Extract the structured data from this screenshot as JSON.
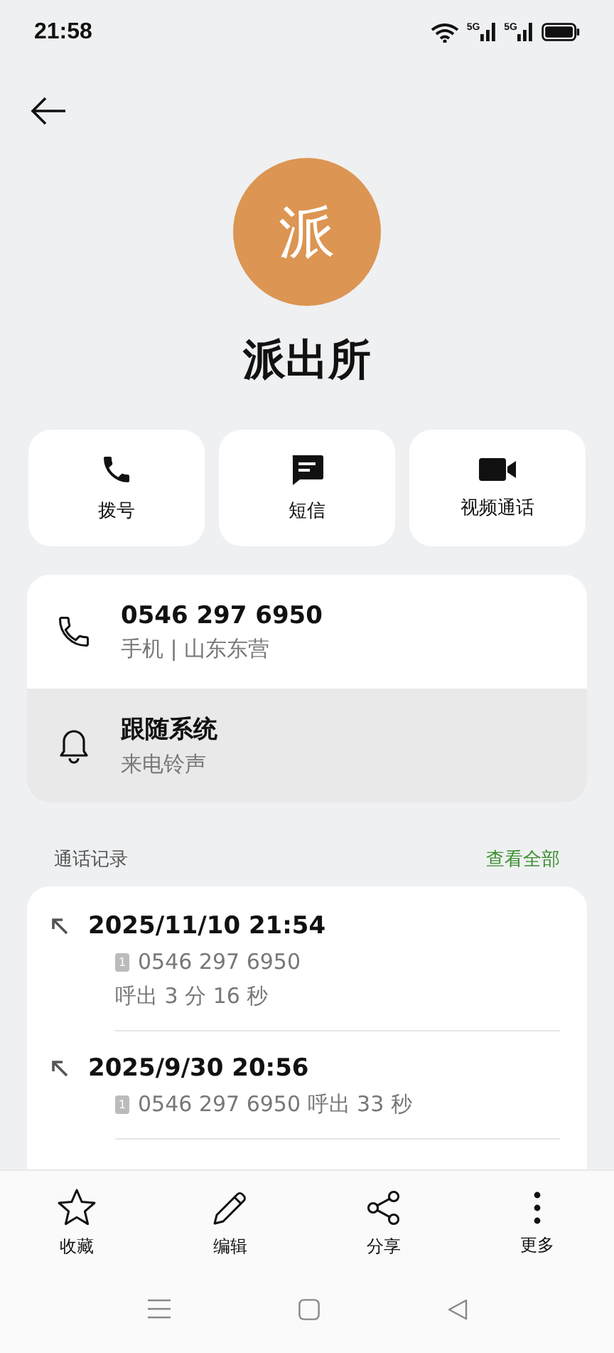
{
  "status_bar": {
    "time": "21:58",
    "sim_labels": [
      "5G",
      "5G"
    ]
  },
  "contact": {
    "avatar_letter": "派",
    "name": "派出所"
  },
  "actions": [
    {
      "kind": "call",
      "label": "拨号"
    },
    {
      "kind": "message",
      "label": "短信"
    },
    {
      "kind": "video",
      "label": "视频通话"
    }
  ],
  "info": [
    {
      "kind": "phone",
      "title": "0546 297 6950",
      "subtitle": "手机 | 山东东营",
      "highlighted": false
    },
    {
      "kind": "ringtone",
      "title": "跟随系统",
      "subtitle": "来电铃声",
      "highlighted": true
    }
  ],
  "call_log": {
    "title": "通话记录",
    "view_all": "查看全部",
    "entries": [
      {
        "kind": "outgoing",
        "datetime": "2025/11/10 21:54",
        "sim": "1",
        "lines": [
          "0546 297 6950",
          "呼出  3 分 16 秒"
        ]
      },
      {
        "kind": "outgoing",
        "datetime": "2025/9/30 20:56",
        "sim": "1",
        "lines": [
          "0546 297 6950 呼出  33 秒"
        ]
      }
    ]
  },
  "bottom_actions": [
    {
      "kind": "star",
      "label": "收藏"
    },
    {
      "kind": "edit",
      "label": "编辑"
    },
    {
      "kind": "share",
      "label": "分享"
    },
    {
      "kind": "more",
      "label": "更多"
    }
  ]
}
